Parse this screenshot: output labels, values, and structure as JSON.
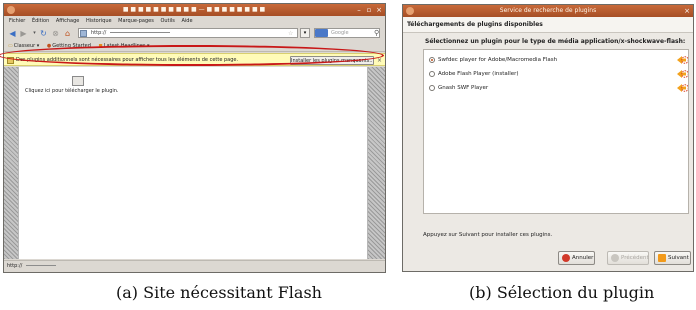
{
  "panel_a": {
    "window_title": "■ ■ ■ ■ ■ ■ ■ ■ ■ ■ — ■ ■ ■ ■ ■ ■ ■ ■",
    "menu": [
      "Fichier",
      "Édition",
      "Affichage",
      "Historique",
      "Marque-pages",
      "Outils",
      "Aide"
    ],
    "url": "http://",
    "search_placeholder": "Google",
    "bookmarks": [
      "Classeur ▾",
      "Getting Started",
      "Latest Headlines ▾"
    ],
    "notification_text": "Des plugins additionnels sont nécessaires pour afficher tous les éléments de cette page.",
    "notification_button": "Installer les plugins manquants...",
    "plugin_placeholder_text": "Cliquez ici pour télécharger le plugin.",
    "status_text": "http://",
    "caption": "(a) Site nécessitant Flash",
    "colors": {
      "titlebar": "#b85a2e",
      "notification_bg": "#fffbb8",
      "highlight_oval": "#c81818"
    }
  },
  "panel_b": {
    "window_title": "Service de recherche de plugins",
    "header": "Téléchargements de plugins disponibles",
    "prompt": "Sélectionnez un plugin pour le type de média application/x-shockwave-flash:",
    "options": [
      {
        "label": "Swfdec player for Adobe/Macromedia Flash",
        "selected": true
      },
      {
        "label": "Adobe Flash Player (installer)",
        "selected": false
      },
      {
        "label": "Gnash SWF Player",
        "selected": false
      }
    ],
    "hint": "Appuyez sur Suivant pour installer ces plugins.",
    "buttons": {
      "cancel": "Annuler",
      "prev": "Précédent",
      "next": "Suivant"
    },
    "caption": "(b) Sélection du plugin",
    "colors": {
      "titlebar": "#b85a2e",
      "selected_radio": "#c0521f"
    }
  }
}
